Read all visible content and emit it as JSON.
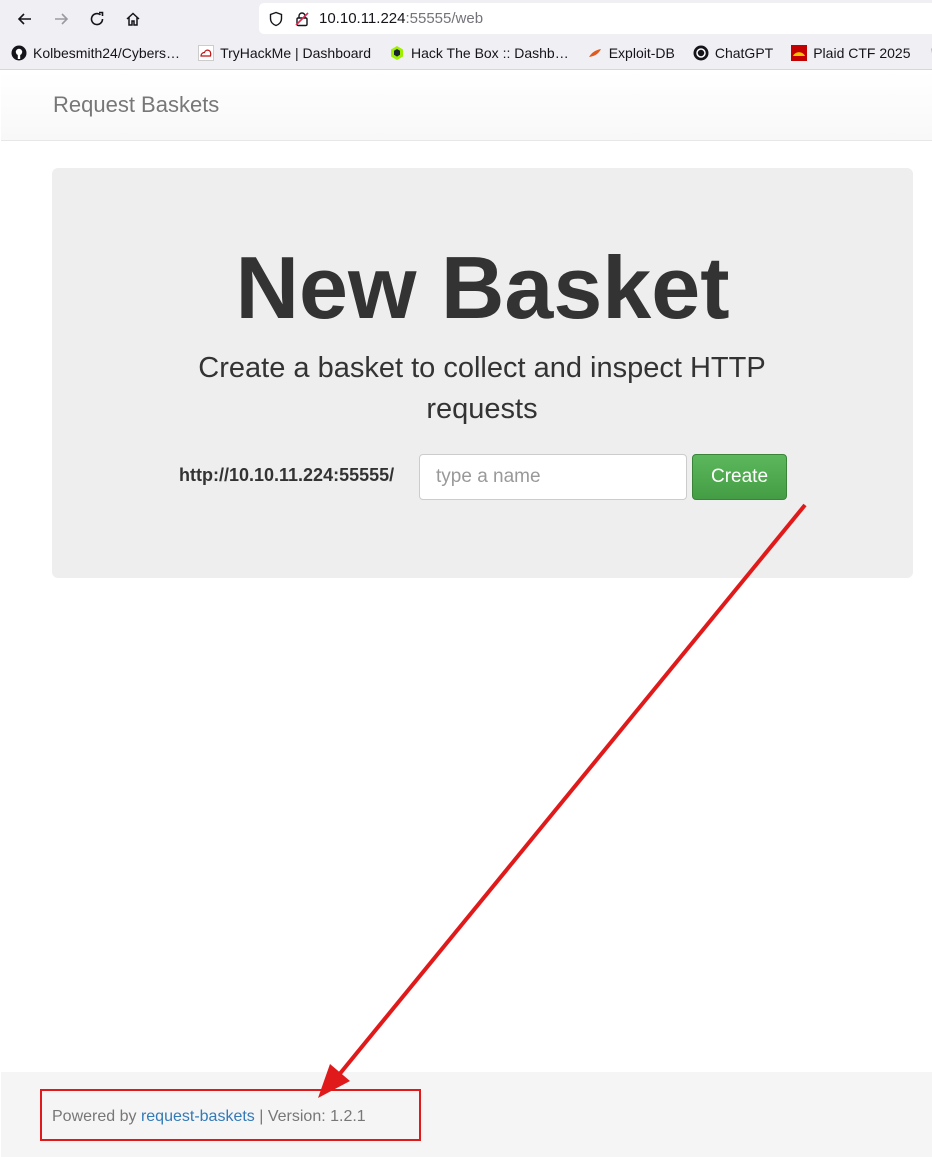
{
  "browser": {
    "url_host": "10.10.11.224",
    "url_rest": ":55555/web",
    "bookmarks": [
      {
        "label": "Kolbesmith24/Cybers…",
        "icon": "github-icon"
      },
      {
        "label": "TryHackMe | Dashboard",
        "icon": "tryhackme-icon"
      },
      {
        "label": "Hack The Box :: Dashb…",
        "icon": "hackthebox-icon"
      },
      {
        "label": "Exploit-DB",
        "icon": "exploitdb-icon"
      },
      {
        "label": "ChatGPT",
        "icon": "chatgpt-icon"
      },
      {
        "label": "Plaid CTF 2025",
        "icon": "plaidctf-icon"
      }
    ]
  },
  "navbar": {
    "brand": "Request Baskets"
  },
  "jumbotron": {
    "title": "New Basket",
    "subtitle": "Create a basket to collect and inspect HTTP requests",
    "base_url": "http://10.10.11.224:55555/",
    "input_placeholder": "type a name",
    "create_label": "Create"
  },
  "footer": {
    "powered_by": "Powered by",
    "link_text": "request-baskets",
    "version_text": "| Version: 1.2.1"
  },
  "colors": {
    "annotation": "#e01a1a",
    "create_button": "#5cb85c",
    "link": "#337ab7"
  }
}
